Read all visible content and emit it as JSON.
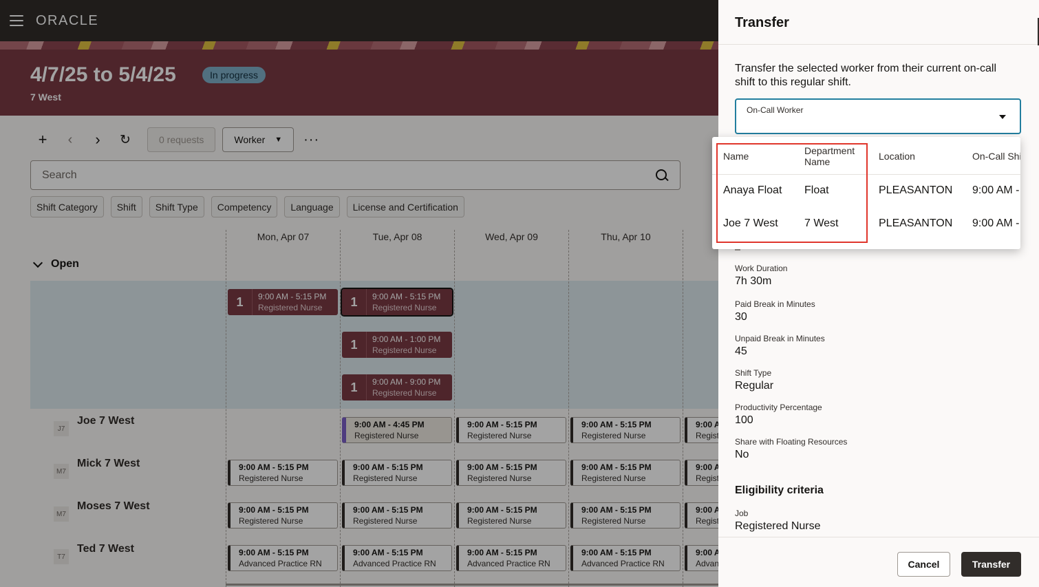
{
  "header": {
    "logo": "ORACLE"
  },
  "banner": {
    "title": "4/7/25 to 5/4/25",
    "status": "In progress",
    "subtitle": "7 West"
  },
  "toolbar": {
    "add_icon": "+",
    "prev_icon": "‹",
    "next_icon": "›",
    "refresh_icon": "↻",
    "requests_label": "0 requests",
    "view_label": "Worker",
    "more_icon": "···"
  },
  "search": {
    "placeholder": "Search",
    "value": ""
  },
  "filters": [
    "Shift Category",
    "Shift",
    "Shift Type",
    "Competency",
    "Language",
    "License and Certification"
  ],
  "days": [
    "Mon, Apr 07",
    "Tue, Apr 08",
    "Wed, Apr 09",
    "Thu, Apr 10"
  ],
  "open_section": {
    "label": "Open"
  },
  "open_shifts": [
    {
      "count": "1",
      "time": "9:00 AM - 5:15 PM",
      "role": "Registered Nurse"
    },
    {
      "count": "1",
      "time": "9:00 AM - 5:15 PM",
      "role": "Registered Nurse"
    },
    {
      "count": "1",
      "time": "9:00 AM - 1:00 PM",
      "role": "Registered Nurse"
    },
    {
      "count": "1",
      "time": "9:00 AM - 9:00 PM",
      "role": "Registered Nurse"
    }
  ],
  "workers": [
    {
      "initials": "J7",
      "name": "Joe 7 West",
      "shifts": [
        {
          "time": "9:00 AM - 4:45 PM",
          "role": "Registered Nurse"
        },
        {
          "time": "9:00 AM - 5:15 PM",
          "role": "Registered Nurse"
        },
        {
          "time": "9:00 AM - 5:15 PM",
          "role": "Registered Nurse"
        },
        {
          "time": "9:00 A",
          "role": "Regist"
        }
      ]
    },
    {
      "initials": "M7",
      "name": "Mick 7 West",
      "shifts": [
        {
          "time": "9:00 AM - 5:15 PM",
          "role": "Registered Nurse"
        },
        {
          "time": "9:00 AM - 5:15 PM",
          "role": "Registered Nurse"
        },
        {
          "time": "9:00 AM - 5:15 PM",
          "role": "Registered Nurse"
        },
        {
          "time": "9:00 AM - 5:15 PM",
          "role": "Registered Nurse"
        },
        {
          "time": "9:00 A",
          "role": "Regist"
        }
      ]
    },
    {
      "initials": "M7",
      "name": "Moses 7 West",
      "shifts": [
        {
          "time": "9:00 AM - 5:15 PM",
          "role": "Registered Nurse"
        },
        {
          "time": "9:00 AM - 5:15 PM",
          "role": "Registered Nurse"
        },
        {
          "time": "9:00 AM - 5:15 PM",
          "role": "Registered Nurse"
        },
        {
          "time": "9:00 AM - 5:15 PM",
          "role": "Registered Nurse"
        },
        {
          "time": "9:00 A",
          "role": "Regist"
        }
      ]
    },
    {
      "initials": "T7",
      "name": "Ted 7 West",
      "shifts": [
        {
          "time": "9:00 AM - 5:15 PM",
          "role": "Advanced Practice RN"
        },
        {
          "time": "9:00 AM - 5:15 PM",
          "role": "Advanced Practice RN"
        },
        {
          "time": "9:00 AM - 5:15 PM",
          "role": "Advanced Practice RN"
        },
        {
          "time": "9:00 AM - 5:15 PM",
          "role": "Advanced Practice RN"
        },
        {
          "time": "9:00 A",
          "role": "Advan"
        }
      ]
    }
  ],
  "drawer": {
    "title": "Transfer",
    "description": "Transfer the selected worker from their current on-call shift to this regular shift.",
    "select_label": "On-Call Worker",
    "fields": [
      {
        "label": "Work Duration",
        "value": "7h 30m"
      },
      {
        "label": "Paid Break in Minutes",
        "value": "30"
      },
      {
        "label": "Unpaid Break in Minutes",
        "value": "45"
      },
      {
        "label": "Shift Type",
        "value": "Regular"
      },
      {
        "label": "Productivity Percentage",
        "value": "100"
      },
      {
        "label": "Share with Floating Resources",
        "value": "No"
      }
    ],
    "eligibility_heading": "Eligibility criteria",
    "job_label": "Job",
    "job_value": "Registered Nurse",
    "cancel_label": "Cancel",
    "transfer_label": "Transfer"
  },
  "dropdown": {
    "columns": [
      "Name",
      "Department Name",
      "Location",
      "On-Call Shi"
    ],
    "rows": [
      {
        "name": "Anaya Float",
        "department": "Float",
        "location": "PLEASANTON",
        "shift": "9:00 AM -"
      },
      {
        "name": "Joe 7 West",
        "department": "7 West",
        "location": "PLEASANTON",
        "shift": "9:00 AM -"
      }
    ]
  }
}
